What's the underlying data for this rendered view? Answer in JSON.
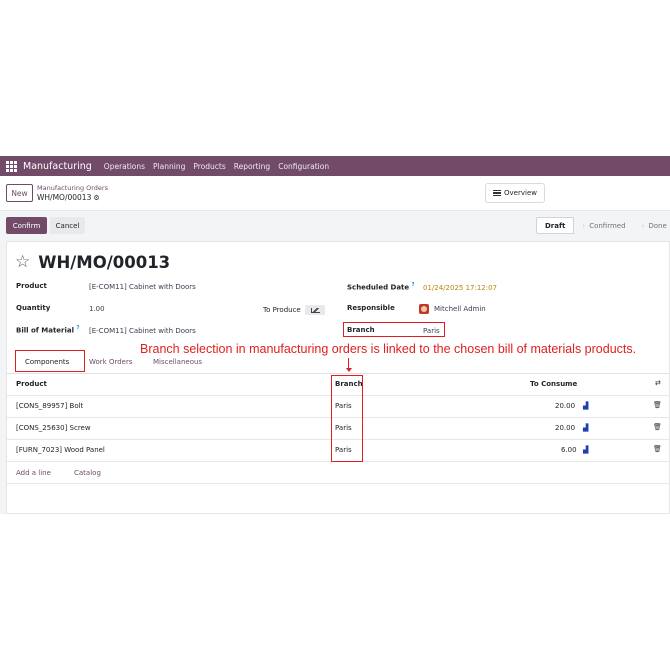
{
  "navbar": {
    "app_name": "Manufacturing",
    "menus": [
      "Operations",
      "Planning",
      "Products",
      "Reporting",
      "Configuration"
    ]
  },
  "control_panel": {
    "new_label": "New",
    "breadcrumb_parent": "Manufacturing Orders",
    "breadcrumb_current": "WH/MO/00013",
    "overview_label": "Overview"
  },
  "actions": {
    "confirm_label": "Confirm",
    "cancel_label": "Cancel",
    "stages": [
      "Draft",
      "Confirmed",
      "Done"
    ]
  },
  "form": {
    "title": "WH/MO/00013",
    "product_label": "Product",
    "product_value": "[E-COM11] Cabinet with Doors",
    "quantity_label": "Quantity",
    "quantity_value": "1.00",
    "to_produce_label": "To Produce",
    "bom_label": "Bill of Material",
    "bom_help": "?",
    "bom_value": "[E-COM11] Cabinet with Doors",
    "scheduled_label": "Scheduled Date",
    "scheduled_help": "?",
    "scheduled_value": "01/24/2025 17:12:07",
    "responsible_label": "Responsible",
    "responsible_value": "Mitchell Admin",
    "branch_label": "Branch",
    "branch_value": "Paris"
  },
  "annotation": {
    "note": "Branch selection in manufacturing orders is linked to the chosen bill of materials products."
  },
  "tabs": [
    "Components",
    "Work Orders",
    "Miscellaneous"
  ],
  "table": {
    "headers": {
      "product": "Product",
      "branch": "Branch",
      "to_consume": "To Consume"
    },
    "rows": [
      {
        "product": "[CONS_89957] Bolt",
        "branch": "Paris",
        "to_consume": "20.00"
      },
      {
        "product": "[CONS_25630] Screw",
        "branch": "Paris",
        "to_consume": "20.00"
      },
      {
        "product": "[FURN_7023] Wood Panel",
        "branch": "Paris",
        "to_consume": "6.00"
      }
    ],
    "add_line_label": "Add a line",
    "catalog_label": "Catalog"
  },
  "colors": {
    "brand": "#714b67",
    "annotation": "#e02020",
    "date": "#b8860b"
  }
}
